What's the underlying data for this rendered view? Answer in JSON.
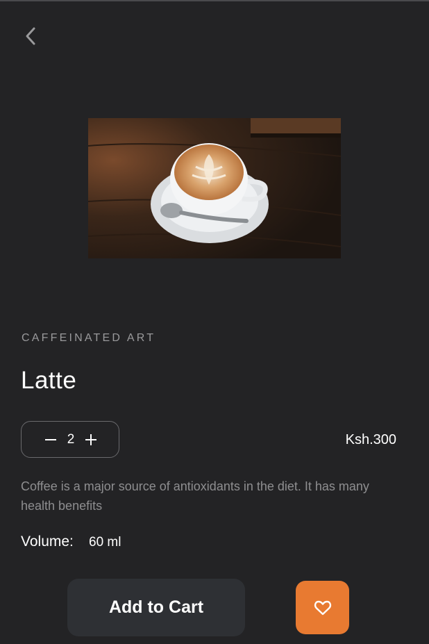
{
  "header": {
    "back_icon": "chevron-left-icon"
  },
  "product": {
    "image_alt": "latte-cup-photo",
    "category": "CAFFEINATED ART",
    "name": "Latte",
    "quantity": "2",
    "price": "Ksh.300",
    "description": "Coffee is a major source of antioxidants in the diet. It has many health benefits",
    "volume_label": "Volume:",
    "volume_value": "60 ml"
  },
  "stepper": {
    "minus_icon": "minus-icon",
    "plus_icon": "plus-icon"
  },
  "actions": {
    "add_to_cart_label": "Add to Cart",
    "favorite_icon": "heart-icon"
  },
  "colors": {
    "background": "#232325",
    "accent": "#e87a31",
    "button_dark": "#2e3034",
    "muted_text": "#8e8e90"
  }
}
